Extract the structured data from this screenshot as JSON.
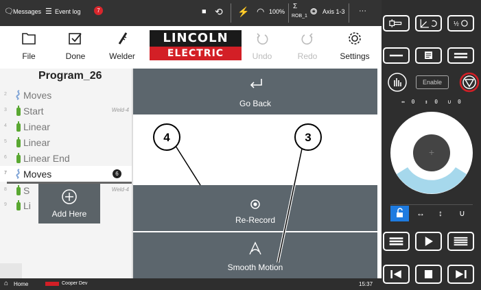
{
  "topbar": {
    "messages": "Messages",
    "event_log": "Event log",
    "event_count": "7",
    "speed": "100%",
    "rob": "ROB_1",
    "axis": "Axis 1-3",
    "more": "···"
  },
  "toolbar": {
    "file": "File",
    "done": "Done",
    "welder": "Welder",
    "logo_top": "LINCOLN",
    "logo_bottom": "ELECTRIC",
    "undo": "Undo",
    "redo": "Redo",
    "settings": "Settings"
  },
  "program": {
    "title": "Program_26",
    "rows": [
      {
        "num": "2",
        "name": "Moves",
        "icon": "squiggle-icon",
        "tag": ""
      },
      {
        "num": "3",
        "name": "Start",
        "icon": "weld-torch-icon",
        "tag": "Weld-4"
      },
      {
        "num": "4",
        "name": "Linear",
        "icon": "weld-torch-icon",
        "tag": ""
      },
      {
        "num": "5",
        "name": "Linear",
        "icon": "weld-torch-icon",
        "tag": ""
      },
      {
        "num": "6",
        "name": "Linear End",
        "icon": "weld-torch-icon",
        "tag": ""
      },
      {
        "num": "7",
        "name": "Moves",
        "icon": "squiggle-icon",
        "tag": ""
      },
      {
        "num": "8",
        "name": "S",
        "icon": "weld-torch-icon",
        "tag": "Weld-4"
      },
      {
        "num": "9",
        "name": "Li",
        "icon": "weld-torch-icon",
        "tag": ""
      }
    ],
    "selected_badge": "6",
    "add_here": "Add Here"
  },
  "actions": {
    "go_back": "Go Back",
    "re_record": "Re-Record",
    "smooth_motion": "Smooth Motion"
  },
  "callouts": {
    "a": "4",
    "b": "3"
  },
  "pendant": {
    "enable": "Enable",
    "axes_readout": "↔  0   ↕  0   ∪  0",
    "axis_buttons": [
      "↔",
      "↕",
      "∪"
    ]
  },
  "status": {
    "home": "Home",
    "user": "Cooper Dev",
    "time": "15:37"
  },
  "colors": {
    "topbar": "#333333",
    "card": "#5c666d",
    "green": "#5aa832",
    "red": "#d31f26",
    "blue": "#1e7be0",
    "lightblue": "#a6d8ec"
  }
}
